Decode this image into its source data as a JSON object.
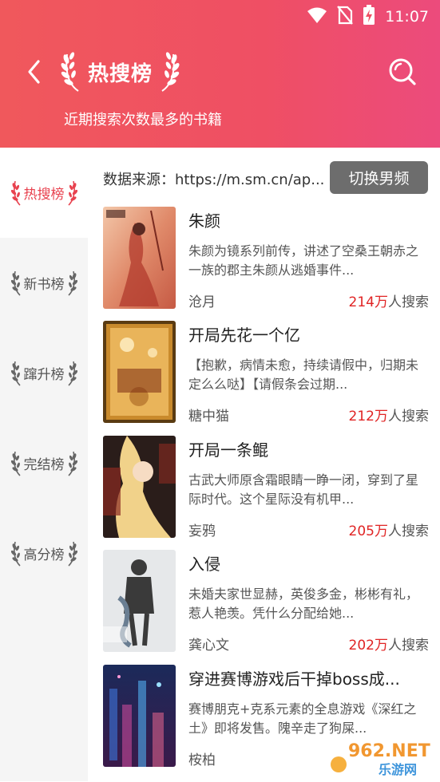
{
  "status": {
    "time": "11:07"
  },
  "header": {
    "title": "热搜榜",
    "subtitle": "近期搜索次数最多的书籍"
  },
  "sidebar": {
    "items": [
      {
        "label": "热搜榜",
        "active": true
      },
      {
        "label": "新书榜",
        "active": false
      },
      {
        "label": "蹿升榜",
        "active": false
      },
      {
        "label": "完结榜",
        "active": false
      },
      {
        "label": "高分榜",
        "active": false
      }
    ]
  },
  "main": {
    "source": "数据来源：https://m.sm.cn/ap...",
    "switch_label": "切换男频",
    "search_suffix": "人搜索",
    "books": [
      {
        "title": "朱颜",
        "desc": "朱颜为镜系列前传，讲述了空桑王朝赤之一族的郡主朱颜从逃婚事件...",
        "author": "沧月",
        "count": "214万"
      },
      {
        "title": "开局先花一个亿",
        "desc": "【抱歉，病情未愈，持续请假中，归期未定么么哒】【请假条会过期...",
        "author": "糖中猫",
        "count": "212万"
      },
      {
        "title": "开局一条鲲",
        "desc": "古武大师原含霜眼睛一睁一闭，穿到了星际时代。这个星际没有机甲...",
        "author": "妄鸦",
        "count": "205万"
      },
      {
        "title": "入侵",
        "desc": "未婚夫家世显赫，英俊多金，彬彬有礼，惹人艳羡。凭什么分配给她...",
        "author": "龚心文",
        "count": "202万"
      },
      {
        "title": "穿进赛博游戏后干掉boss成...",
        "desc": "赛博朋克+克系元素的全息游戏《深红之土》即将发售。隗辛走了狗屎...",
        "author": "桉柏",
        "count": ""
      }
    ]
  },
  "watermark": {
    "text_top": "962.NET",
    "text_bottom": "乐游网"
  },
  "colors": {
    "accent": "#e8424f",
    "count": "#e02424",
    "switch_bg": "#6d6d6d"
  }
}
